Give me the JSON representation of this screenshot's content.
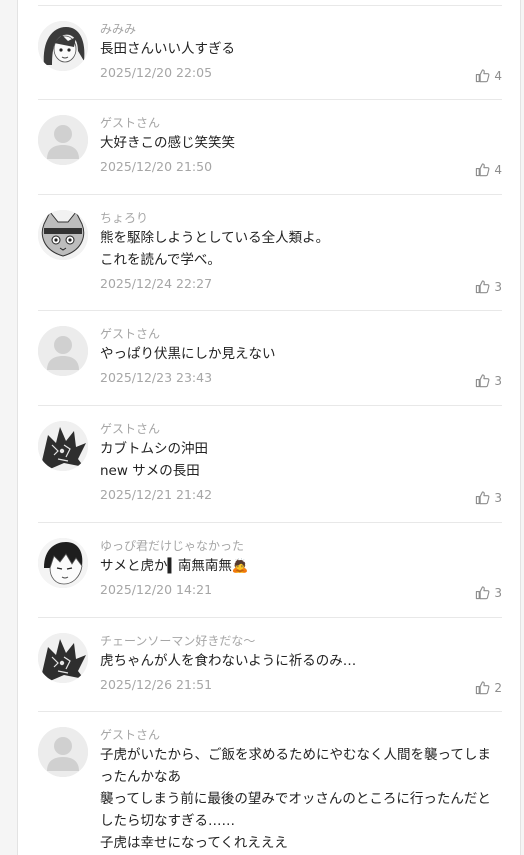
{
  "comments": [
    {
      "user": "みみみ",
      "text": "長田さんいい人すぎる",
      "date": "2025/12/20 22:05",
      "likes": "4",
      "avatar": "manga-girl"
    },
    {
      "user": "ゲストさん",
      "text": "大好きこの感じ笑笑笑",
      "date": "2025/12/20 21:50",
      "likes": "4",
      "avatar": "guest"
    },
    {
      "user": "ちょろり",
      "text": "熊を駆除しようとしている全人類よ。\nこれを読んで学べ。",
      "date": "2025/12/24 22:27",
      "likes": "3",
      "avatar": "cat"
    },
    {
      "user": "ゲストさん",
      "text": "やっぱり伏黒にしか見えない",
      "date": "2025/12/23 23:43",
      "likes": "3",
      "avatar": "guest"
    },
    {
      "user": "ゲストさん",
      "text": "カブトムシの沖田\nnew サメの長田",
      "date": "2025/12/21 21:42",
      "likes": "3",
      "avatar": "chainsaw"
    },
    {
      "user": "ゆっぴ君だけじゃなかった",
      "text": "サメと虎か▍南無南無🙇",
      "date": "2025/12/20 14:21",
      "likes": "3",
      "avatar": "manga-boy"
    },
    {
      "user": "チェーンソーマン好きだな〜",
      "text": "虎ちゃんが人を食わないように祈るのみ…",
      "date": "2025/12/26 21:51",
      "likes": "2",
      "avatar": "chainsaw"
    },
    {
      "user": "ゲストさん",
      "text": "子虎がいたから、ご飯を求めるためにやむなく人間を襲ってしまったんかなあ\n襲ってしまう前に最後の望みでオッさんのところに行ったんだとしたら切なすぎる……\n子虎は幸せになってくれえええ",
      "date": "",
      "likes": "",
      "avatar": "guest"
    }
  ],
  "icons": {
    "like": "thumbs-up-icon"
  },
  "colors": {
    "meta": "#a6a6a6",
    "text": "#222222",
    "divider": "#e8e8e8"
  }
}
